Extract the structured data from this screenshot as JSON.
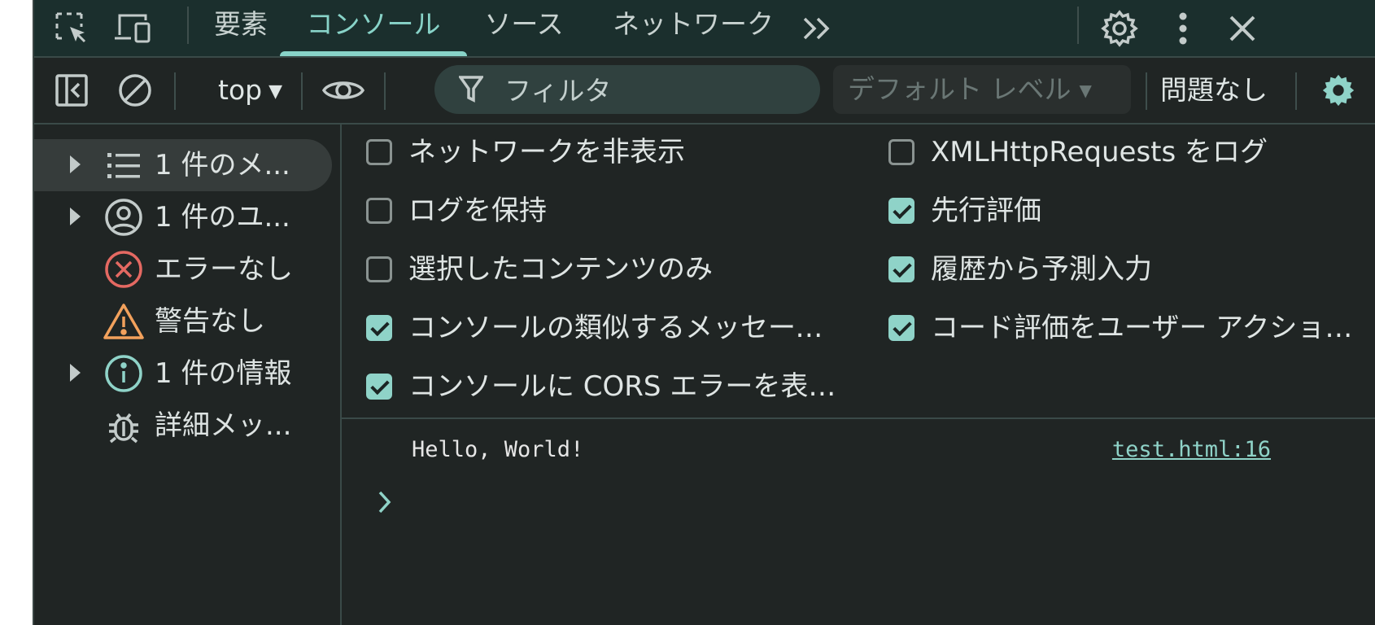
{
  "tabs": {
    "items": [
      {
        "label": "要素"
      },
      {
        "label": "コンソール",
        "active": true
      },
      {
        "label": "ソース"
      },
      {
        "label": "ネットワーク"
      }
    ],
    "more_icon": "chevron-double-right-icon",
    "icons": [
      "element-picker-icon",
      "device-toolbar-icon",
      "settings-gear-icon",
      "more-vertical-icon",
      "close-icon"
    ]
  },
  "toolbar": {
    "context": "top",
    "filter_placeholder": "フィルタ",
    "levels": "デフォルト レベル",
    "issues": "問題なし",
    "icons": [
      "sidebar-toggle-icon",
      "clear-console-icon",
      "live-expression-eye-icon",
      "filter-funnel-icon",
      "console-settings-gear-icon"
    ]
  },
  "sidebar": {
    "items": [
      {
        "label": "1 件のメ...",
        "icon": "list-icon",
        "expandable": true,
        "selected": true
      },
      {
        "label": "1 件のユ...",
        "icon": "user-circle-icon",
        "expandable": true
      },
      {
        "label": "エラーなし",
        "icon": "error-circle-icon"
      },
      {
        "label": "警告なし",
        "icon": "warning-triangle-icon"
      },
      {
        "label": "1 件の情報",
        "icon": "info-circle-icon",
        "expandable": true
      },
      {
        "label": "詳細メッ...",
        "icon": "bug-icon"
      }
    ]
  },
  "settings": {
    "left": [
      {
        "label": "ネットワークを非表示",
        "checked": false
      },
      {
        "label": "ログを保持",
        "checked": false
      },
      {
        "label": "選択したコンテンツのみ",
        "checked": false
      },
      {
        "label": "コンソールの類似するメッセージ…",
        "checked": true
      },
      {
        "label": "コンソールに CORS エラーを表…",
        "checked": true
      }
    ],
    "right": [
      {
        "label": "XMLHttpRequests をログ",
        "checked": false
      },
      {
        "label": "先行評価",
        "checked": true
      },
      {
        "label": "履歴から予測入力",
        "checked": true
      },
      {
        "label": "コード評価をユーザー アクショ…",
        "checked": true
      }
    ]
  },
  "console": {
    "message": "Hello, World!",
    "source": "test.html:16",
    "prompt_icon": "chevron-right-icon"
  },
  "colors": {
    "accent": "#8fd3c8",
    "background": "#202524",
    "tabbar": "#1b2f2d",
    "error": "#e46962",
    "warning": "#f2a15c",
    "info": "#8fd3c8"
  }
}
